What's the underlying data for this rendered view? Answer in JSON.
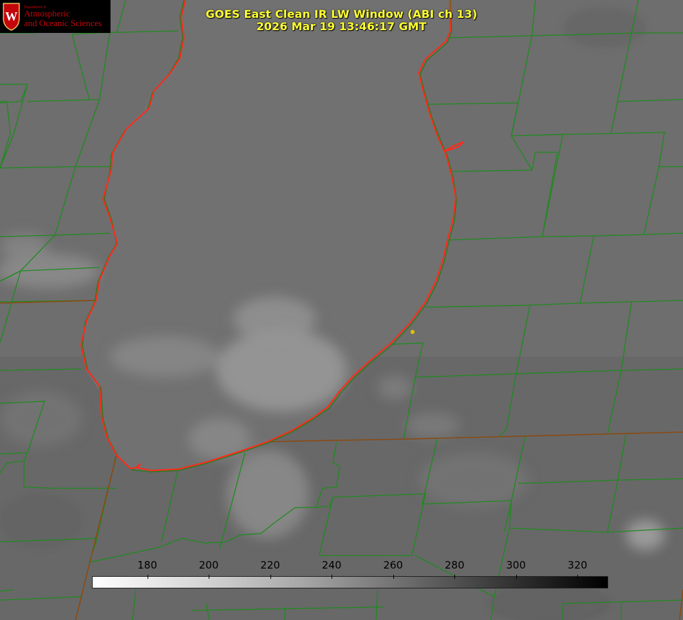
{
  "title": {
    "line1": "GOES East Clean IR LW Window (ABI ch 13)",
    "line2": "2026 Mar 19 13:46:17 GMT"
  },
  "logo": {
    "department": "Department of",
    "line1": "Atmospheric",
    "line2": "and Oceanic Sciences",
    "crest_letter": "W",
    "crest_color": "#c5050c"
  },
  "colorbar": {
    "range_min": 162,
    "range_max": 330,
    "colormap": "white (cold) to black (warm)",
    "ticks": [
      "180",
      "200",
      "220",
      "240",
      "260",
      "280",
      "300",
      "320"
    ]
  },
  "colors": {
    "shoreline": "#ff2a1a",
    "county_lines": "#1f8a1f",
    "state_lines": "#8a4a12",
    "station_marker": "#e0c000",
    "title_text": "#ffff33"
  }
}
